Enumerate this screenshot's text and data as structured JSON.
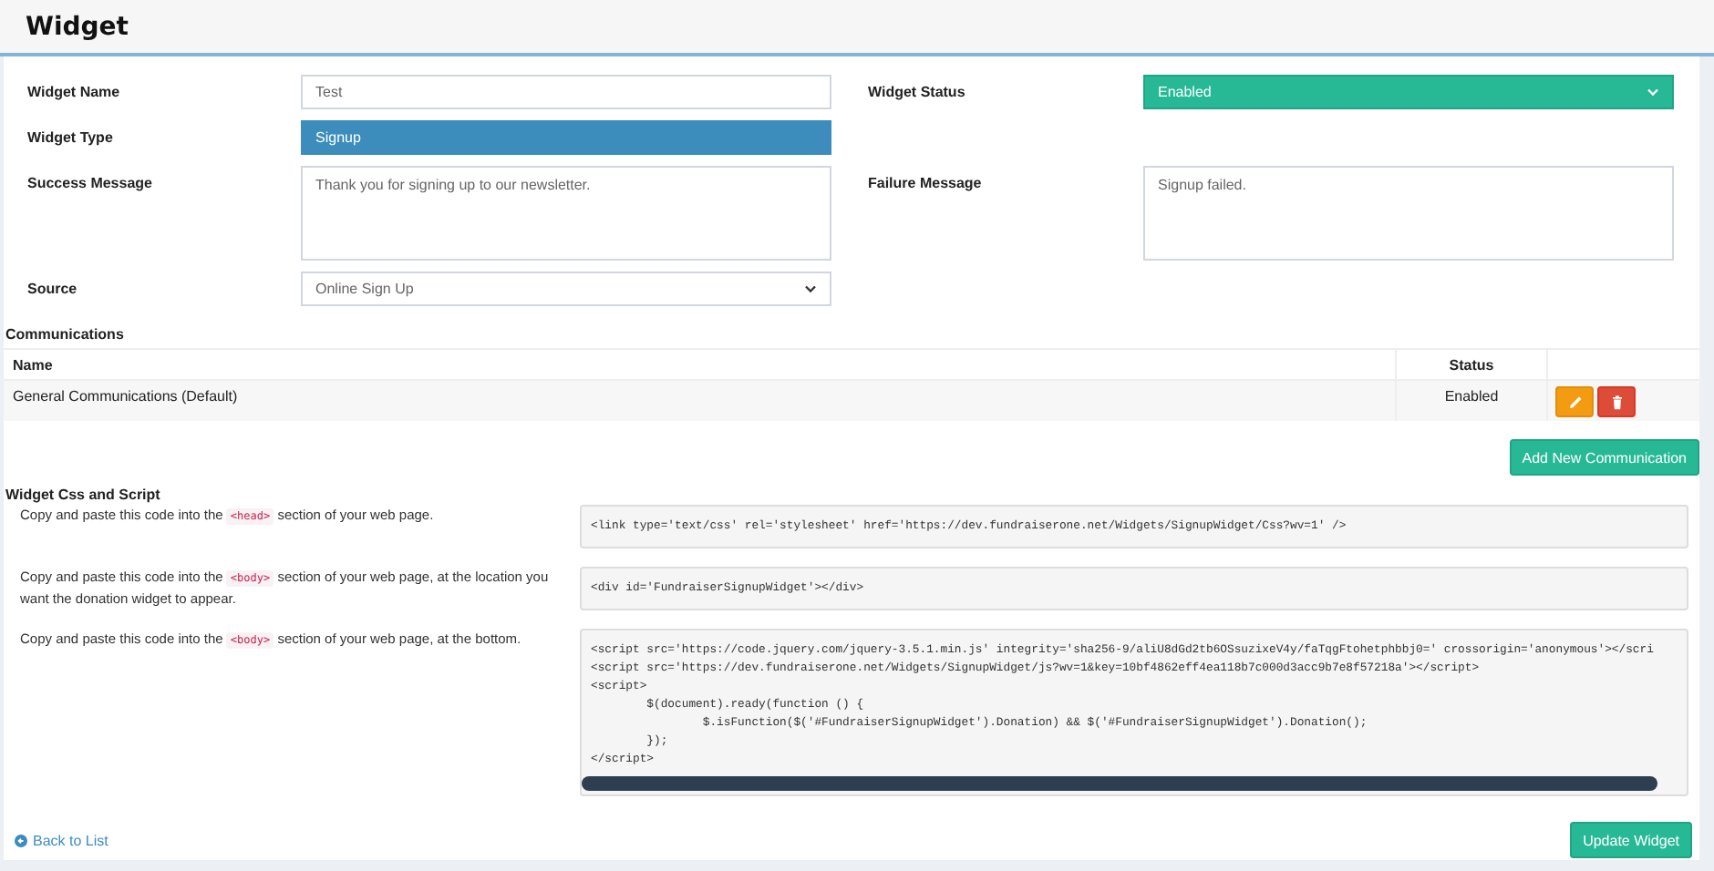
{
  "page": {
    "title": "Widget"
  },
  "form": {
    "fields": [
      {
        "kind": "input",
        "label": "Widget Name",
        "value": "Test"
      },
      {
        "kind": "status",
        "label": "Widget Status",
        "value": "Enabled"
      },
      {
        "kind": "type",
        "label": "Widget Type",
        "value": "Signup"
      },
      {
        "kind": "blank"
      },
      {
        "kind": "textarea",
        "label": "Success Message",
        "value": "Thank you for signing up to our newsletter."
      },
      {
        "kind": "textarea",
        "label": "Failure Message",
        "value": "Signup failed."
      },
      {
        "kind": "select",
        "label": "Source",
        "value": "Online Sign Up"
      }
    ]
  },
  "communications": {
    "title": "Communications",
    "columns": [
      "Name",
      "Status"
    ],
    "rows": [
      {
        "name": "General Communications (Default)",
        "status": "Enabled"
      }
    ],
    "add_button": "Add New Communication"
  },
  "script_section": {
    "title": "Widget Css and Script",
    "items": [
      {
        "before": "Copy and paste this code into the ",
        "tag": "<head>",
        "after": " section of your web page.",
        "code": [
          "<link type='text/css' rel='stylesheet' href='https://dev.fundraiserone.net/Widgets/SignupWidget/Css?wv=1' />"
        ],
        "scrollbar": false
      },
      {
        "before": "Copy and paste this code into the ",
        "tag": "<body>",
        "after": " section of your web page, at the location you want the donation widget to appear.",
        "code": [
          "<div id='FundraiserSignupWidget'></div>"
        ],
        "scrollbar": false
      },
      {
        "before": "Copy and paste this code into the ",
        "tag": "<body>",
        "after": " section of your web page, at the bottom.",
        "code": [
          "<script src='https://code.jquery.com/jquery-3.5.1.min.js' integrity='sha256-9/aliU8dGd2tb6OSsuzixeV4y/faTqgFtohetphbbj0=' crossorigin='anonymous'></scri",
          "<script src='https://dev.fundraiserone.net/Widgets/SignupWidget/js?wv=1&key=10bf4862eff4ea118b7c000d3acc9b7e8f57218a'></script>",
          "<script>",
          "        $(document).ready(function () {",
          "                $.isFunction($('#FundraiserSignupWidget').Donation) && $('#FundraiserSignupWidget').Donation();",
          "        });",
          "</script>"
        ],
        "scrollbar": true
      }
    ]
  },
  "footer": {
    "back_link": "Back to List",
    "submit_button": "Update Widget"
  }
}
